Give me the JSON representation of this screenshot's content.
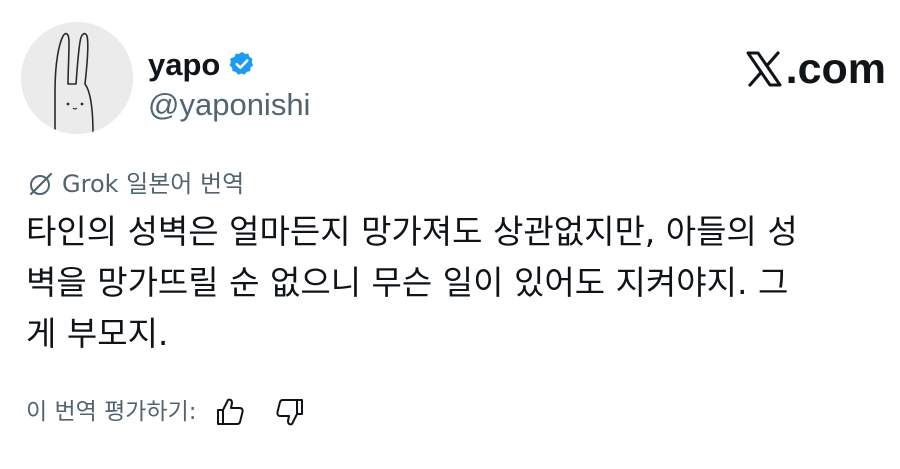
{
  "author": {
    "display_name": "yapo",
    "handle": "@yaponishi",
    "verified": true,
    "avatar_icon": "bunny-doodle-icon"
  },
  "brand": {
    "logo_icon": "x-logo-icon",
    "domain": ".com"
  },
  "translation": {
    "icon": "grok-icon",
    "label": "Grok 일본어 번역"
  },
  "tweet": {
    "lines": [
      "타인의 성벽은 얼마든지 망가져도 상관없지만, 아들의 성",
      "벽을 망가뜨릴 순 없으니 무슨 일이 있어도 지켜야지. 그",
      "게 부모지."
    ]
  },
  "rating": {
    "label": "이 번역 평가하기:",
    "thumbs_up_icon": "thumbs-up-icon",
    "thumbs_down_icon": "thumbs-down-icon"
  },
  "colors": {
    "text": "#0f1419",
    "secondary": "#536471",
    "verified_blue": "#1d9bf0",
    "avatar_bg": "#ebebeb"
  }
}
